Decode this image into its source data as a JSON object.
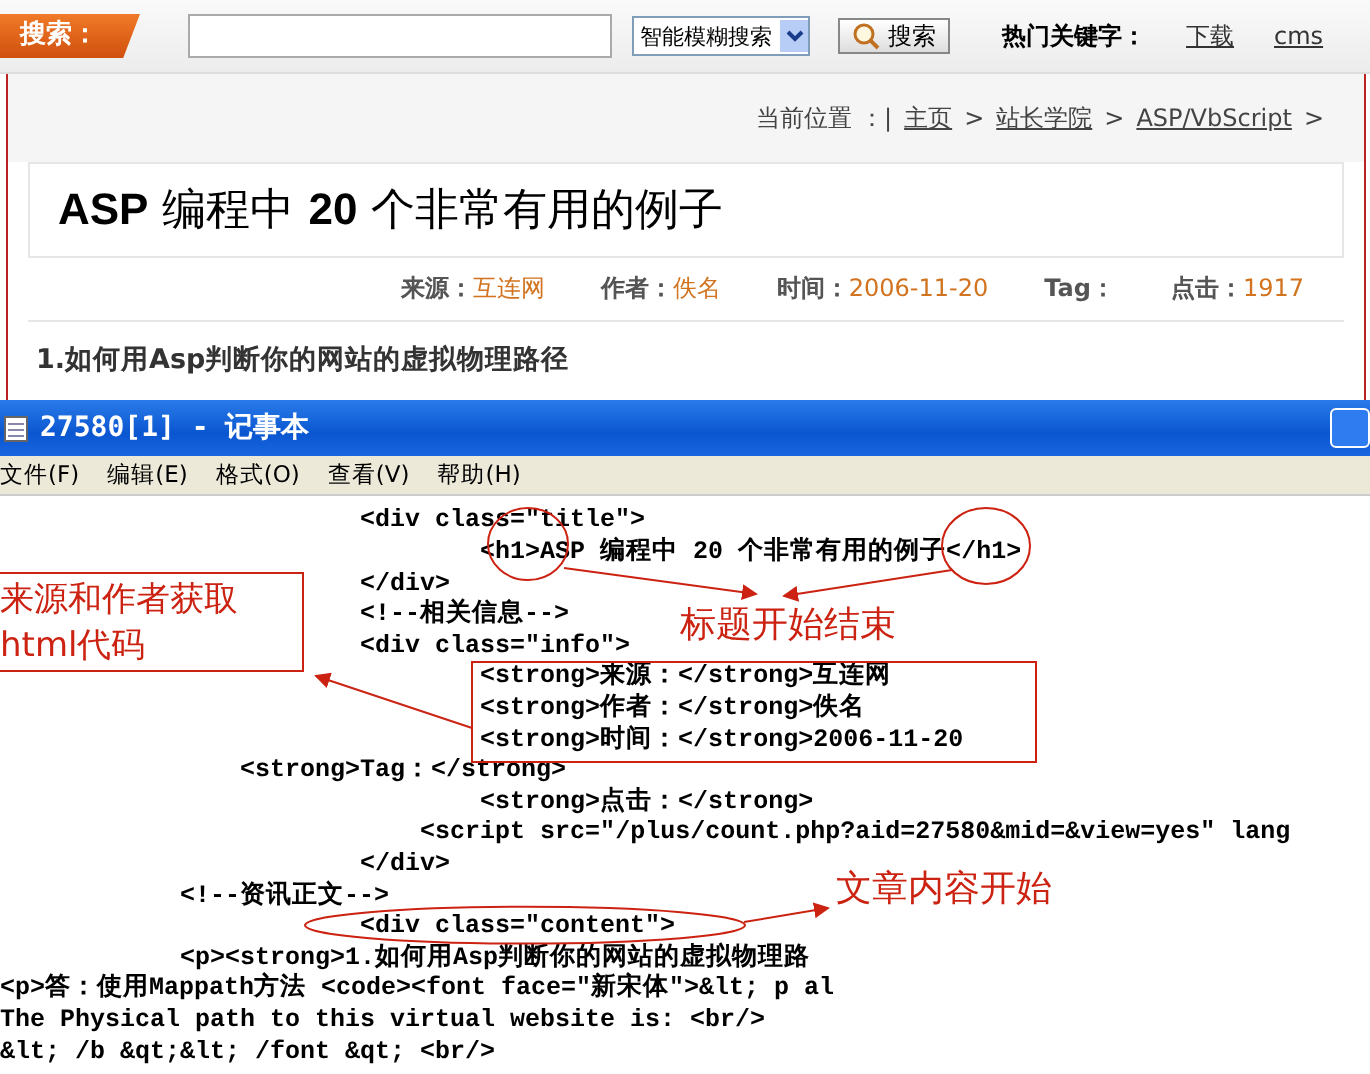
{
  "search_bar": {
    "label": "搜索：",
    "mode": "智能模糊搜索",
    "button": "搜索",
    "hot_label": "热门关键字：",
    "hot_links": [
      "下载",
      "cms"
    ]
  },
  "breadcrumb": {
    "label": "当前位置 ：|",
    "items": [
      {
        "label": "主页",
        "after": ">"
      },
      {
        "label": "站长学院",
        "after": ">"
      },
      {
        "label": "ASP/VbScript",
        "after": ">"
      }
    ]
  },
  "article": {
    "title": "**ASP** 编程中  **20** 个非常有用的例子",
    "meta": [
      {
        "label": "来源：",
        "value": "互连网"
      },
      {
        "label": "作者：",
        "value": "佚名"
      },
      {
        "label": "时间：",
        "value": "2006-11-20"
      },
      {
        "label": "Tag："
      },
      {
        "label": "点击：",
        "value": "1917"
      }
    ],
    "section_heading": "1.如何用Asp判断你的网站的虚拟物理路径"
  },
  "notepad": {
    "title": "27580[1] - 记事本",
    "menu": [
      "文件(F)",
      "编辑(E)",
      "格式(O)",
      "查看(V)",
      "帮助(H)"
    ],
    "lines": [
      "                        <div class=\"title\">",
      "                                <h1>ASP 编程中 20 个非常有用的例子</h1>",
      "                        </div>",
      "                        <!--相关信息-->",
      "                        <div class=\"info\">",
      "                                <strong>来源：</strong>互连网",
      "                                <strong>作者：</strong>佚名",
      "                                <strong>时间：</strong>2006-11-20",
      "                <strong>Tag：</strong>",
      "                                <strong>点击：</strong>",
      "                            <script src=\"/plus/count.php?aid=27580&mid=&view=yes\" lang",
      "                        </div>",
      "            <!--资讯正文-->",
      "                        <div class=\"content\">",
      "            <p><strong>1.如何用Asp判断你的网站的虚拟物理路",
      "<p>答：使用Mappath方法 <code><font face=\"新宋体\">&lt; p al",
      "The Physical path to this virtual website is: <br/>",
      "&lt; /b &qt;&lt; /font &qt; <br/>"
    ]
  },
  "annotations": {
    "title_note": "标题开始结束",
    "source_note": [
      "来源和作者获取",
      "html代码"
    ],
    "content_note": "文章内容开始"
  }
}
